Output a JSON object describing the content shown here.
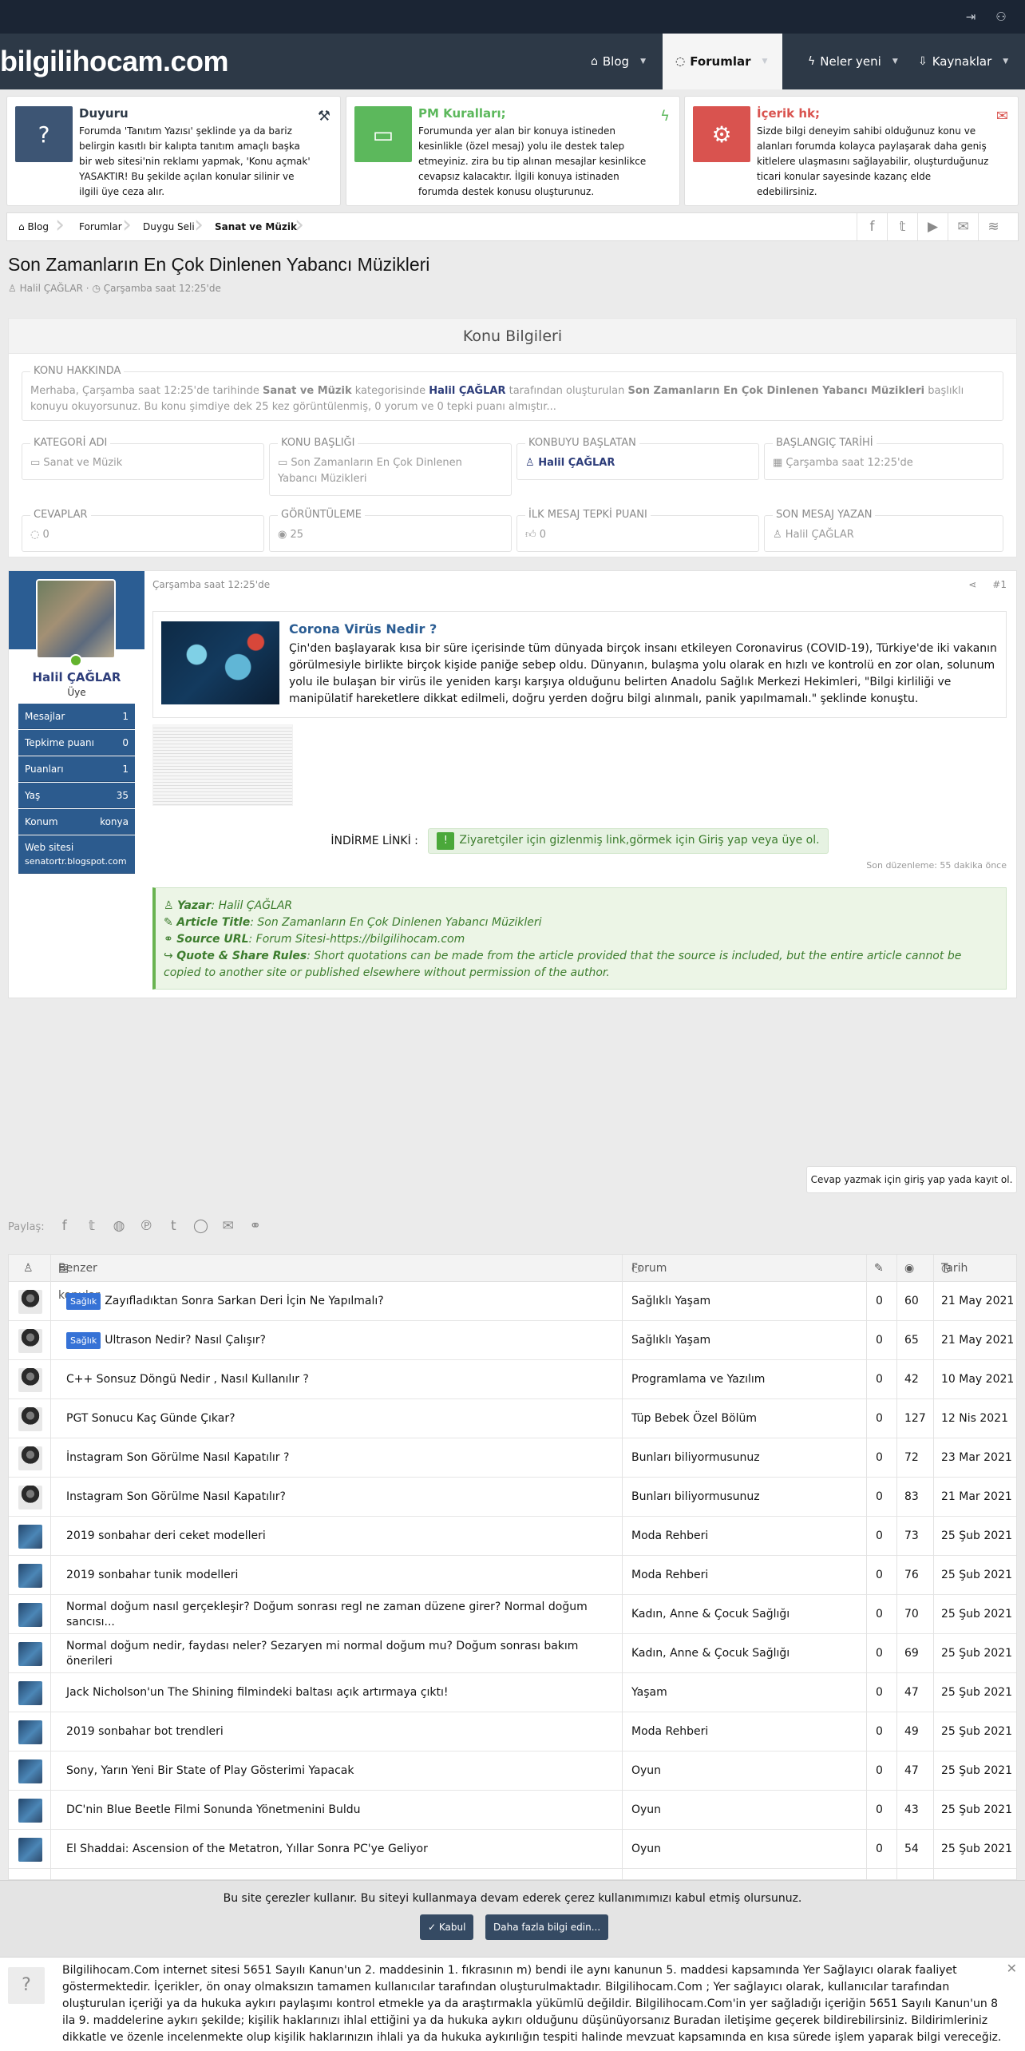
{
  "header": {
    "logo": "bilgilihocam.com",
    "nav": [
      {
        "label": "Blog"
      },
      {
        "label": "Forumlar"
      },
      {
        "label": "Neler yeni"
      },
      {
        "label": "Kaynaklar"
      }
    ]
  },
  "notices": [
    {
      "title": "Duyuru",
      "text": "Forumda 'Tanıtım Yazısı' şeklinde ya da bariz belirgin kasıtlı bir kalıpta tanıtım amaçlı başka bir web sitesi'nin reklamı yapmak, 'Konu açmak' YASAKTIR! Bu şekilde açılan konular silinir ve ilgili üye ceza alır.",
      "color": "#3d5574",
      "title_color": "#2d3947"
    },
    {
      "title": "PM Kuralları;",
      "text": "Forumunda yer alan bir konuya istineden kesinlikle (özel mesaj) yolu ile destek talep etmeyiniz. zira bu tip alınan mesajlar kesinlikce cevapsız kalacaktır. İlgili konuya istinaden forumda destek konusu oluşturunuz.",
      "color": "#5cb85c",
      "title_color": "#5cb85c"
    },
    {
      "title": "İçerik hk;",
      "text": "Sizde bilgi deneyim sahibi olduğunuz konu ve alanları forumda kolayca paylaşarak daha geniş kitlelere ulaşmasını sağlayabilir, oluşturduğunuz ticari konular sayesinde kazanç elde edebilirsiniz.",
      "color": "#d9534f",
      "title_color": "#d9534f"
    }
  ],
  "breadcrumb": [
    "Blog",
    "Forumlar",
    "Duygu Seli",
    "Sanat ve Müzik"
  ],
  "thread": {
    "title": "Son Zamanların En Çok Dinlenen Yabancı Müzikleri",
    "author": "Halil ÇAĞLAR",
    "date": "Çarşamba saat 12:25'de"
  },
  "info": {
    "heading": "Konu Bilgileri",
    "about_label": "KONU HAKKINDA",
    "about_pre": "Merhaba, Çarşamba saat 12:25'de tarihinde ",
    "about_cat": "Sanat ve Müzik",
    "about_mid1": " kategorisinde ",
    "about_user": "Halil ÇAĞLAR",
    "about_mid2": " tarafından oluşturulan ",
    "about_title": "Son Zamanların En Çok Dinlenen Yabancı Müzikleri",
    "about_post": " başlıklı konuyu okuyorsunuz. Bu konu şimdiye dek 25 kez görüntülenmiş, 0 yorum ve 0 tepki puanı almıştır...",
    "fields": [
      {
        "label": "KATEGORİ ADI",
        "value": "Sanat ve Müzik"
      },
      {
        "label": "KONU BAŞLIĞI",
        "value": "Son Zamanların En Çok Dinlenen Yabancı Müzikleri"
      },
      {
        "label": "KONBUYU BAŞLATAN",
        "value": "Halil ÇAĞLAR"
      },
      {
        "label": "BAŞLANGIÇ TARİHİ",
        "value": "Çarşamba saat 12:25'de"
      },
      {
        "label": "CEVAPLAR",
        "value": "0"
      },
      {
        "label": "GÖRÜNTÜLEME",
        "value": "25"
      },
      {
        "label": "İLK MESAJ TEPKİ PUANI",
        "value": "0"
      },
      {
        "label": "SON MESAJ YAZAN",
        "value": "Halil ÇAĞLAR"
      }
    ]
  },
  "post": {
    "user": "Halil ÇAĞLAR",
    "role": "Üye",
    "stats": [
      {
        "label": "Mesajlar",
        "value": "1"
      },
      {
        "label": "Tepkime puanı",
        "value": "0"
      },
      {
        "label": "Puanları",
        "value": "1"
      },
      {
        "label": "Yaş",
        "value": "35"
      },
      {
        "label": "Konum",
        "value": "konya"
      },
      {
        "label": "Web sitesi",
        "value": "senatortr.blogspot.com"
      }
    ],
    "date": "Çarşamba saat 12:25'de",
    "number": "#1",
    "card_title": "Corona Virüs Nedir ?",
    "card_text": "Çin'den başlayarak kısa bir süre içerisinde tüm dünyada birçok insanı etkileyen Coronavirus (COVID-19), Türkiye'de iki vakanın görülmesiyle birlikte birçok kişide paniğe sebep oldu. Dünyanın, bulaşma yolu olarak en hızlı ve kontrolü en zor olan, solunum yolu ile bulaşan bir virüs ile yeniden karşı karşıya olduğunu belirten Anadolu Sağlık Merkezi Hekimleri, \"Bilgi kirliliği ve manipülatif hareketlere dikkat edilmeli, doğru yerden doğru bilgi alınmalı, panik yapılmamalı.\" şeklinde konuştu.",
    "download_label": "İNDİRME LİNKİ :",
    "download_text": "Ziyaretçiler için gizlenmiş link,görmek için Giriş yap veya üye ol.",
    "edited": "Son düzenleme: 55 dakika önce",
    "source": {
      "author_label": "Yazar",
      "author": "Halil ÇAĞLAR",
      "title_label": "Article Title",
      "title": "Son Zamanların En Çok Dinlenen Yabancı Müzikleri",
      "url_label": "Source URL",
      "url": "Forum Sitesi-https://bilgilihocam.com",
      "rules_label": "Quote & Share Rules",
      "rules": "Short quotations can be made from the article provided that the source is included, but the entire article cannot be copied to another site or published elsewhere without permission of the author."
    }
  },
  "reply_button": "Cevap yazmak için giriş yap yada kayıt ol.",
  "share_label": "Paylaş:",
  "similar": {
    "headers": {
      "title": "Benzer konular",
      "forum": "Forum",
      "date": "Tarih"
    },
    "rows": [
      {
        "badge": "Sağlık",
        "title": "Zayıfladıktan Sonra Sarkan Deri İçin Ne Yapılmalı?",
        "forum": "Sağlıklı Yaşam",
        "replies": "0",
        "views": "60",
        "date": "21 May 2021",
        "av": "a"
      },
      {
        "badge": "Sağlık",
        "title": "Ultrason Nedir? Nasıl Çalışır?",
        "forum": "Sağlıklı Yaşam",
        "replies": "0",
        "views": "65",
        "date": "21 May 2021",
        "av": "a"
      },
      {
        "badge": "",
        "title": "C++ Sonsuz Döngü Nedir , Nasıl Kullanılır ?",
        "forum": "Programlama ve Yazılım",
        "replies": "0",
        "views": "42",
        "date": "10 May 2021",
        "av": "a"
      },
      {
        "badge": "",
        "title": "PGT Sonucu Kaç Günde Çıkar?",
        "forum": "Tüp Bebek Özel Bölüm",
        "replies": "0",
        "views": "127",
        "date": "12 Nis 2021",
        "av": "a"
      },
      {
        "badge": "",
        "title": "İnstagram Son Görülme Nasıl Kapatılır ?",
        "forum": "Bunları biliyormusunuz",
        "replies": "0",
        "views": "72",
        "date": "23 Mar 2021",
        "av": "a"
      },
      {
        "badge": "",
        "title": "Instagram Son Görülme Nasıl Kapatılır?",
        "forum": "Bunları biliyormusunuz",
        "replies": "0",
        "views": "83",
        "date": "21 Mar 2021",
        "av": "a"
      },
      {
        "badge": "",
        "title": "2019 sonbahar deri ceket modelleri",
        "forum": "Moda Rehberi",
        "replies": "0",
        "views": "73",
        "date": "25 Şub 2021",
        "av": "b"
      },
      {
        "badge": "",
        "title": "2019 sonbahar tunik modelleri",
        "forum": "Moda Rehberi",
        "replies": "0",
        "views": "76",
        "date": "25 Şub 2021",
        "av": "b"
      },
      {
        "badge": "",
        "title": "Normal doğum nasıl gerçekleşir? Doğum sonrası regl ne zaman düzene girer? Normal doğum sancısı...",
        "forum": "Kadın, Anne & Çocuk Sağlığı",
        "replies": "0",
        "views": "70",
        "date": "25 Şub 2021",
        "av": "b"
      },
      {
        "badge": "",
        "title": "Normal doğum nedir, faydası neler? Sezaryen mi normal doğum mu? Doğum sonrası bakım önerileri",
        "forum": "Kadın, Anne & Çocuk Sağlığı",
        "replies": "0",
        "views": "69",
        "date": "25 Şub 2021",
        "av": "b"
      },
      {
        "badge": "",
        "title": "Jack Nicholson'un The Shining filmindeki baltası açık artırmaya çıktı!",
        "forum": "Yaşam",
        "replies": "0",
        "views": "47",
        "date": "25 Şub 2021",
        "av": "b"
      },
      {
        "badge": "",
        "title": "2019 sonbahar bot trendleri",
        "forum": "Moda Rehberi",
        "replies": "0",
        "views": "49",
        "date": "25 Şub 2021",
        "av": "b"
      },
      {
        "badge": "",
        "title": "Sony, Yarın Yeni Bir State of Play Gösterimi Yapacak",
        "forum": "Oyun",
        "replies": "0",
        "views": "47",
        "date": "25 Şub 2021",
        "av": "b"
      },
      {
        "badge": "",
        "title": "DC'nin Blue Beetle Filmi Sonunda Yönetmenini Buldu",
        "forum": "Oyun",
        "replies": "0",
        "views": "43",
        "date": "25 Şub 2021",
        "av": "b"
      },
      {
        "badge": "",
        "title": "El Shaddai: Ascension of the Metatron, Yıllar Sonra PC'ye Geliyor",
        "forum": "Oyun",
        "replies": "0",
        "views": "54",
        "date": "25 Şub 2021",
        "av": "b"
      }
    ]
  },
  "cookie": {
    "text": "Bu site çerezler kullanır. Bu siteyi kullanmaya devam ederek çerez kullanımımızı kabul etmiş olursunuz.",
    "accept": "Kabul",
    "more": "Daha fazla bilgi edin..."
  },
  "legal": "Bilgilihocam.Com internet sitesi 5651 Sayılı Kanun'un 2. maddesinin 1. fıkrasının m) bendi ile aynı kanunun 5. maddesi kapsamında Yer Sağlayıcı olarak faaliyet göstermektedir. İçerikler, ön onay olmaksızın tamamen kullanıcılar tarafından oluşturulmaktadır. Bilgilihocam.Com ; Yer sağlayıcı olarak, kullanıcılar tarafından oluşturulan içeriği ya da hukuka aykırı paylaşımı kontrol etmekle ya da araştırmakla yükümlü değildir. Bilgilihocam.Com'in yer sağladığı içeriğin 5651 Sayılı Kanun'un 8 ila 9. maddelerine aykırı şekilde; kişilik haklarınızı ihlal ettiğini ya da hukuka aykırı olduğunu düşünüyorsanız Buradan iletişime geçerek bildirebilirsiniz. Bildirimleriniz dikkatle ve özenle incelenmekte olup kişilik haklarınızın ihlali ya da hukuka aykırılığın tespiti halinde mevzuat kapsamında en kısa sürede işlem yaparak bilgi vereceğiz."
}
